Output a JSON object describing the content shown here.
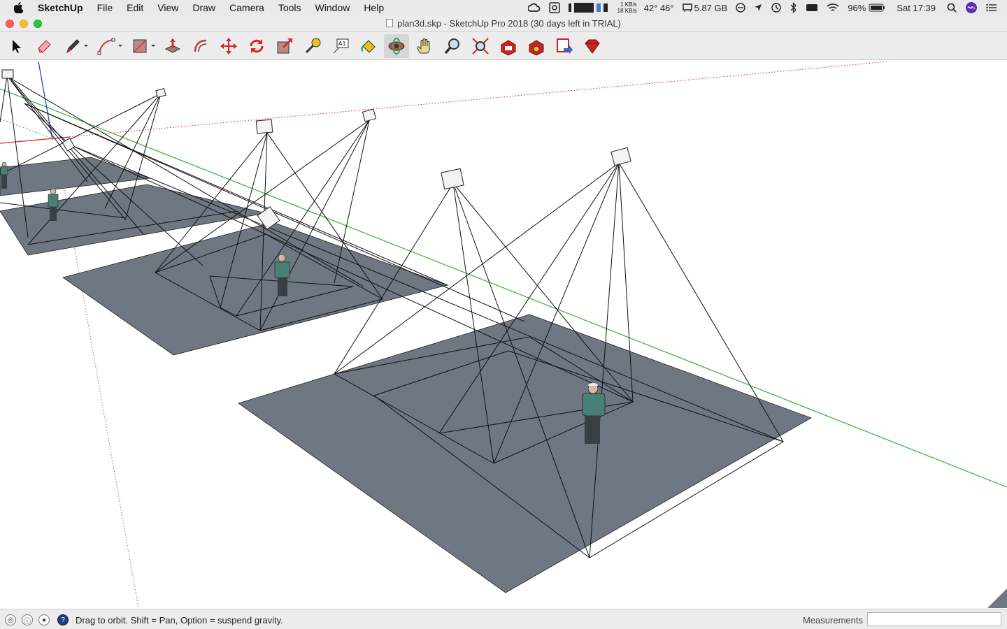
{
  "menubar": {
    "app_name": "SketchUp",
    "menus": [
      "File",
      "Edit",
      "View",
      "Draw",
      "Camera",
      "Tools",
      "Window",
      "Help"
    ],
    "net_up": "1 KB/s",
    "net_down": "18 KB/s",
    "temps": "42° 46°",
    "memory": "5.87 GB",
    "battery": "96%",
    "clock": "Sat 17:39"
  },
  "window": {
    "title": "plan3d.skp - SketchUp Pro 2018 (30 days left in TRIAL)"
  },
  "toolbar": {
    "tools": [
      {
        "name": "select-tool",
        "icon": "arrow-cursor-icon"
      },
      {
        "name": "eraser-tool",
        "icon": "eraser-icon"
      },
      {
        "name": "line-tool",
        "icon": "pencil-icon"
      },
      {
        "name": "arc-tool",
        "icon": "arc-icon"
      },
      {
        "name": "rectangle-tool",
        "icon": "rectangle-icon"
      },
      {
        "name": "push-pull-tool",
        "icon": "push-pull-icon"
      },
      {
        "name": "offset-tool",
        "icon": "offset-icon"
      },
      {
        "name": "move-tool",
        "icon": "move-arrows-icon"
      },
      {
        "name": "rotate-tool",
        "icon": "rotate-icon"
      },
      {
        "name": "scale-tool",
        "icon": "scale-icon"
      },
      {
        "name": "tape-measure-tool",
        "icon": "tape-measure-icon"
      },
      {
        "name": "text-tool",
        "icon": "text-label-icon"
      },
      {
        "name": "paint-bucket-tool",
        "icon": "paint-bucket-icon"
      },
      {
        "name": "orbit-tool",
        "icon": "orbit-icon"
      },
      {
        "name": "pan-tool",
        "icon": "hand-icon"
      },
      {
        "name": "zoom-tool",
        "icon": "magnifier-icon"
      },
      {
        "name": "zoom-extents-tool",
        "icon": "zoom-extents-icon"
      },
      {
        "name": "warehouse-tool",
        "icon": "3d-warehouse-icon"
      },
      {
        "name": "extension-warehouse-tool",
        "icon": "extension-warehouse-icon"
      },
      {
        "name": "send-to-layout-tool",
        "icon": "layout-icon"
      },
      {
        "name": "extension-manager-tool",
        "icon": "ruby-gem-icon"
      }
    ],
    "active_tool": "orbit-tool"
  },
  "statusbar": {
    "hint": "Drag to orbit. Shift = Pan, Option = suspend gravity.",
    "measurements_label": "Measurements",
    "measurements_value": ""
  },
  "colors": {
    "floor": "#6f7782",
    "green_axis": "#2db52d",
    "red_axis": "#d22",
    "blue_axis": "#2233cc"
  }
}
